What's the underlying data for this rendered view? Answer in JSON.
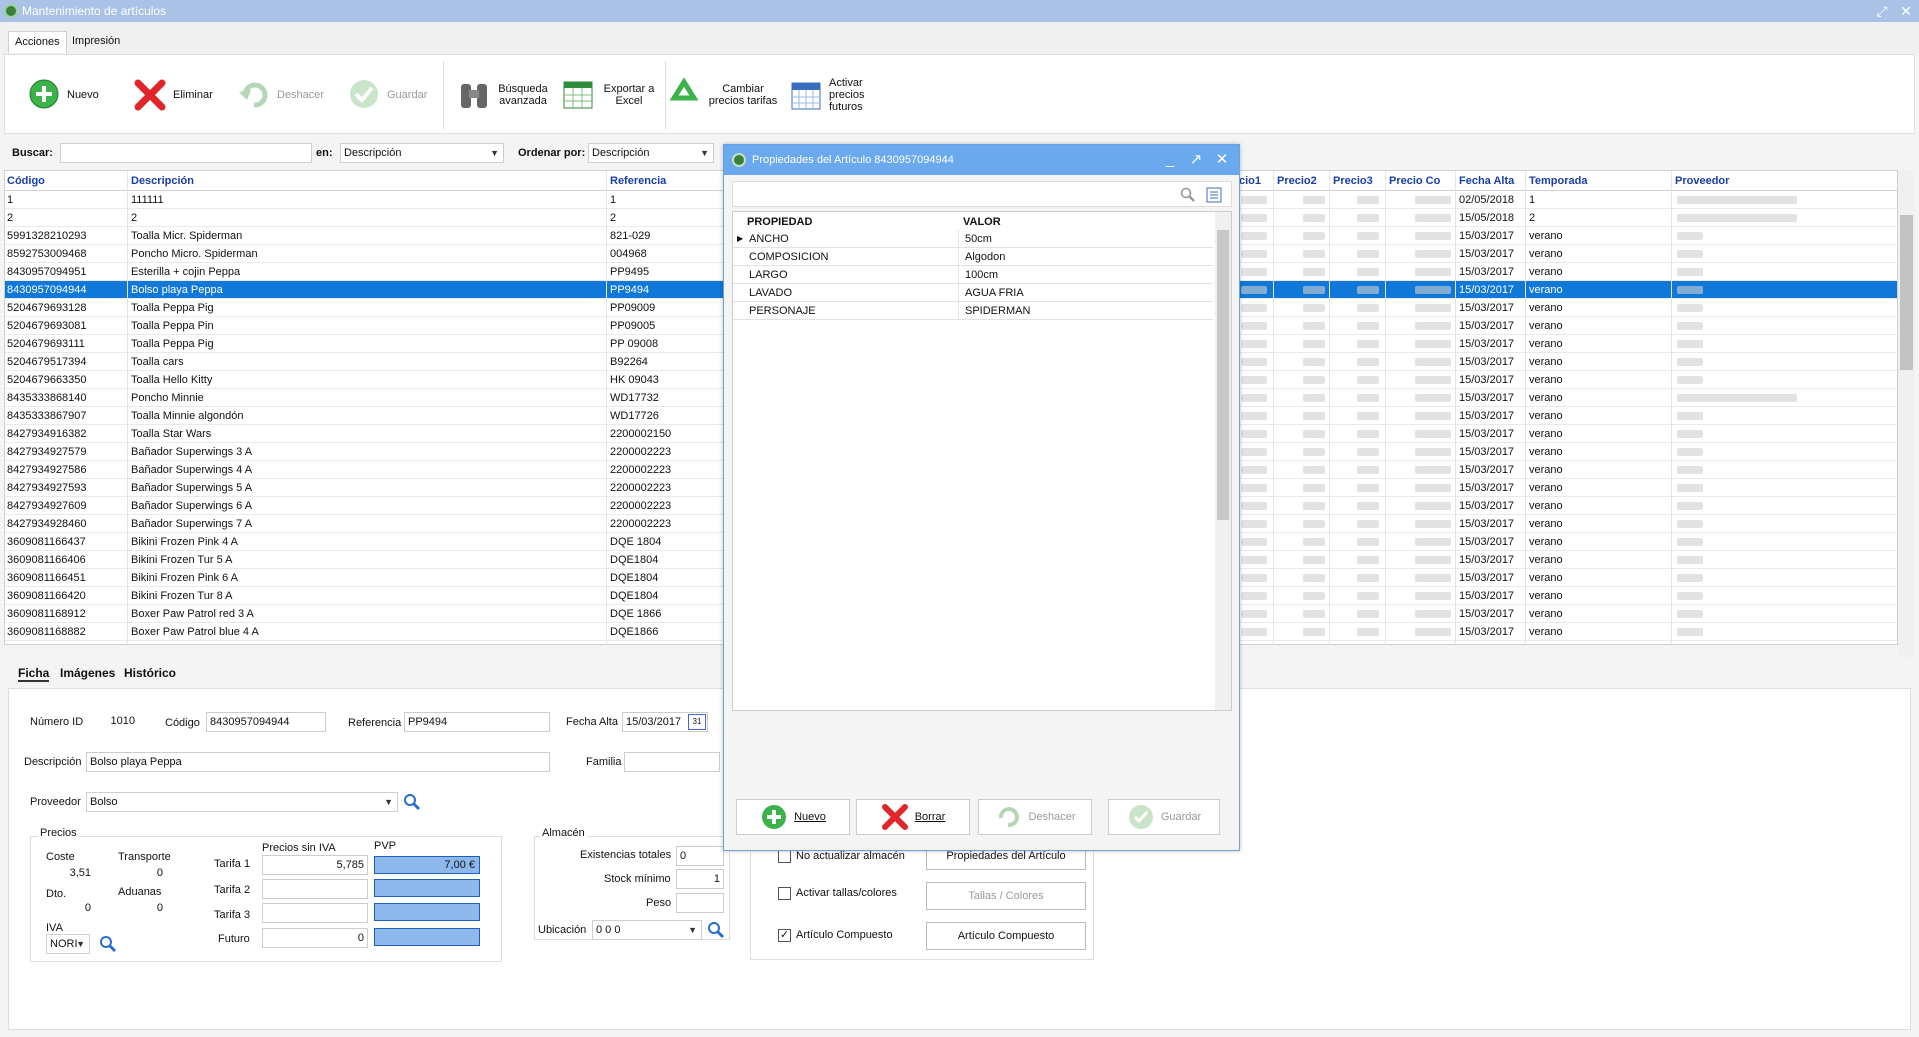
{
  "window": {
    "title": "Mantenimiento de artículos",
    "min_icon": "restore-icon",
    "close_icon": "close-icon"
  },
  "ribbon_tabs": [
    "Acciones",
    "Impresión"
  ],
  "ribbon": {
    "nuevo": "Nuevo",
    "eliminar": "Eliminar",
    "deshacer": "Deshacer",
    "guardar": "Guardar",
    "busqueda": "Búsqueda avanzada",
    "exportar": "Exportar a Excel",
    "cambiar": "Cambiar precios tarifas",
    "activar": "Activar precios futuros"
  },
  "search": {
    "label": "Buscar:",
    "value": "",
    "en_label": "en:",
    "en_value": "Descripción",
    "order_label": "Ordenar por:",
    "order_value": "Descripción"
  },
  "grid": {
    "headers": {
      "codigo": "Código",
      "descripcion": "Descripción",
      "referencia": "Referencia",
      "precio1": "cio1",
      "precio2": "Precio2",
      "precio3": "Precio3",
      "precio_co": "Precio Co",
      "fecha_alta": "Fecha Alta",
      "temporada": "Temporada",
      "proveedor": "Proveedor"
    },
    "rows": [
      {
        "codigo": "1",
        "descripcion": "111111",
        "referencia": "1",
        "fecha": "02/05/2018",
        "temporada": "1"
      },
      {
        "codigo": "2",
        "descripcion": "2",
        "referencia": "2",
        "fecha": "15/05/2018",
        "temporada": "2"
      },
      {
        "codigo": "5991328210293",
        "descripcion": "Toalla Micr. Spiderman",
        "referencia": "821-029",
        "fecha": "15/03/2017",
        "temporada": "verano"
      },
      {
        "codigo": "8592753009468",
        "descripcion": "Poncho Micro. Spiderman",
        "referencia": "004968",
        "fecha": "15/03/2017",
        "temporada": "verano"
      },
      {
        "codigo": "8430957094951",
        "descripcion": "Esterilla + cojin Peppa",
        "referencia": "PP9495",
        "fecha": "15/03/2017",
        "temporada": "verano"
      },
      {
        "codigo": "8430957094944",
        "descripcion": "Bolso playa Peppa",
        "referencia": "PP9494",
        "fecha": "15/03/2017",
        "temporada": "verano"
      },
      {
        "codigo": "5204679693128",
        "descripcion": "Toalla Peppa Pig",
        "referencia": "PP09009",
        "fecha": "15/03/2017",
        "temporada": "verano"
      },
      {
        "codigo": "5204679693081",
        "descripcion": "Toalla Peppa Pin",
        "referencia": "PP09005",
        "fecha": "15/03/2017",
        "temporada": "verano"
      },
      {
        "codigo": "5204679693111",
        "descripcion": "Toalla Peppa Pig",
        "referencia": "PP 09008",
        "fecha": "15/03/2017",
        "temporada": "verano"
      },
      {
        "codigo": "5204679517394",
        "descripcion": "Toalla cars",
        "referencia": "B92264",
        "fecha": "15/03/2017",
        "temporada": "verano"
      },
      {
        "codigo": "5204679663350",
        "descripcion": "Toalla Hello Kitty",
        "referencia": "HK 09043",
        "fecha": "15/03/2017",
        "temporada": "verano"
      },
      {
        "codigo": "8435333868140",
        "descripcion": "Poncho Minnie",
        "referencia": "WD17732",
        "fecha": "15/03/2017",
        "temporada": "verano"
      },
      {
        "codigo": "8435333867907",
        "descripcion": "Toalla Minnie algondón",
        "referencia": "WD17726",
        "fecha": "15/03/2017",
        "temporada": "verano"
      },
      {
        "codigo": "8427934916382",
        "descripcion": "Toalla Star Wars",
        "referencia": "2200002150",
        "fecha": "15/03/2017",
        "temporada": "verano"
      },
      {
        "codigo": "8427934927579",
        "descripcion": "Bañador Superwings 3 A",
        "referencia": "2200002223",
        "fecha": "15/03/2017",
        "temporada": "verano"
      },
      {
        "codigo": "8427934927586",
        "descripcion": "Bañador Superwings 4 A",
        "referencia": "2200002223",
        "fecha": "15/03/2017",
        "temporada": "verano"
      },
      {
        "codigo": "8427934927593",
        "descripcion": "Bañador Superwings 5 A",
        "referencia": "2200002223",
        "fecha": "15/03/2017",
        "temporada": "verano"
      },
      {
        "codigo": "8427934927609",
        "descripcion": "Bañador Superwings 6 A",
        "referencia": "2200002223",
        "fecha": "15/03/2017",
        "temporada": "verano"
      },
      {
        "codigo": "8427934928460",
        "descripcion": "Bañador Superwings 7 A",
        "referencia": "2200002223",
        "fecha": "15/03/2017",
        "temporada": "verano"
      },
      {
        "codigo": "3609081166437",
        "descripcion": "Bikini Frozen Pink 4 A",
        "referencia": "DQE 1804",
        "fecha": "15/03/2017",
        "temporada": "verano"
      },
      {
        "codigo": "3609081166406",
        "descripcion": "Bikini Frozen Tur  5 A",
        "referencia": "DQE1804",
        "fecha": "15/03/2017",
        "temporada": "verano"
      },
      {
        "codigo": "3609081166451",
        "descripcion": "Bikini Frozen Pink 6 A",
        "referencia": "DQE1804",
        "fecha": "15/03/2017",
        "temporada": "verano"
      },
      {
        "codigo": "3609081166420",
        "descripcion": "Bikini Frozen Tur 8 A",
        "referencia": "DQE1804",
        "fecha": "15/03/2017",
        "temporada": "verano"
      },
      {
        "codigo": "3609081168912",
        "descripcion": "Boxer Paw Patrol red 3 A",
        "referencia": "DQE 1866",
        "fecha": "15/03/2017",
        "temporada": "verano"
      },
      {
        "codigo": "3609081168882",
        "descripcion": "Boxer Paw Patrol blue 4 A",
        "referencia": "DQE1866",
        "fecha": "15/03/2017",
        "temporada": "verano"
      }
    ],
    "selected_row": 5
  },
  "detail": {
    "tabs": [
      "Ficha",
      "Imágenes",
      "Histórico"
    ],
    "numero_id_label": "Número ID",
    "numero_id": "1010",
    "codigo_label": "Código",
    "codigo": "8430957094944",
    "referencia_label": "Referencia",
    "referencia": "PP9494",
    "fecha_alta_label": "Fecha Alta",
    "fecha_alta": "15/03/2017",
    "cal_icon": "31",
    "descripcion_label": "Descripción",
    "descripcion": "Bolso playa Peppa",
    "familia_label": "Familia",
    "familia": "",
    "proveedor_label": "Proveedor",
    "proveedor": "Bolso",
    "precios_label": "Precios",
    "coste_label": "Coste",
    "coste": "3,51",
    "transporte_label": "Transporte",
    "transporte": "0",
    "dto_label": "Dto.",
    "dto": "0",
    "aduanas_label": "Aduanas",
    "aduanas": "0",
    "iva_label": "IVA",
    "iva": "NORI",
    "precios_sin_iva_label": "Precios sin IVA",
    "pvp_label": "PVP",
    "tarifa1_label": "Tarifa 1",
    "tarifa1": "5,785",
    "pvp1": "7,00 €",
    "tarifa2_label": "Tarifa 2",
    "tarifa2": "",
    "tarifa3_label": "Tarifa 3",
    "tarifa3": "",
    "futuro_label": "Futuro",
    "futuro": "0",
    "almacen_label": "Almacén",
    "existencias_label": "Existencias totales",
    "existencias": "0",
    "stock_label": "Stock mínimo",
    "stock": "1",
    "peso_label": "Peso",
    "peso": "",
    "ubicacion_label": "Ubicación",
    "ubicacion": "0 0 0",
    "no_actualizar_label": "No actualizar almacén",
    "activar_tallas_label": "Activar tallas/colores",
    "articulo_compuesto_label": "Artículo Compuesto",
    "propiedades_btn": "Propiedades del Artículo",
    "tallas_btn": "Tallas / Colores",
    "compuesto_btn": "Artículo Compuesto",
    "articulo_compuesto_checked": true
  },
  "dialog": {
    "title": "Propiedades del Artículo 8430957094944",
    "col_propiedad": "PROPIEDAD",
    "col_valor": "VALOR",
    "rows": [
      {
        "propiedad": "ANCHO",
        "valor": "50cm"
      },
      {
        "propiedad": "COMPOSICION",
        "valor": "Algodon"
      },
      {
        "propiedad": "LARGO",
        "valor": "100cm"
      },
      {
        "propiedad": "LAVADO",
        "valor": "AGUA FRIA"
      },
      {
        "propiedad": "PERSONAJE",
        "valor": "SPIDERMAN"
      }
    ],
    "nuevo": "Nuevo",
    "borrar": "Borrar",
    "deshacer": "Deshacer",
    "guardar": "Guardar"
  },
  "colors": {
    "accent": "#1078d8",
    "title": "#a9c2e6",
    "dialog_title": "#6aa9ee",
    "header_text": "#1a3ea8"
  }
}
